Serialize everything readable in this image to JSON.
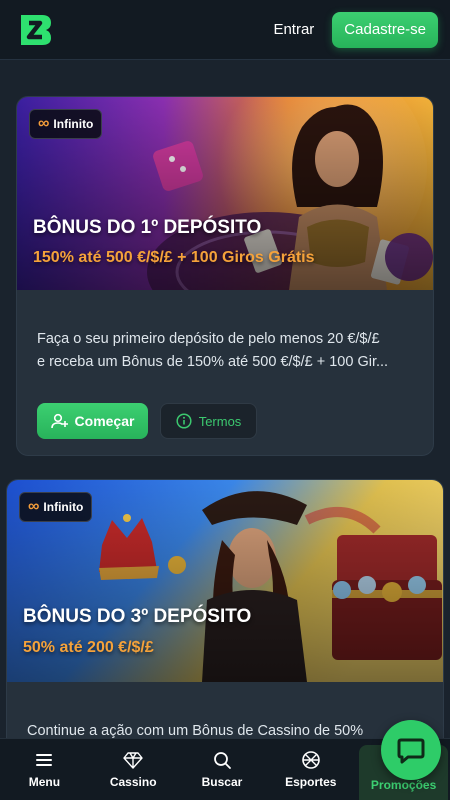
{
  "header": {
    "login_label": "Entrar",
    "signup_label": "Cadastre-se"
  },
  "promotions": [
    {
      "badge": "Infinito",
      "title": "BÔNUS DO 1º DEPÓSITO",
      "subtitle": "150% até 500 €/$/£ + 100 Giros Grátis",
      "description_line1": "Faça o seu primeiro depósito de pelo menos 20 €/$/£",
      "description_line2": "e receba um Bônus de 150% até 500 €/$/£ + 100 Gir...",
      "start_label": "Começar",
      "terms_label": "Termos"
    },
    {
      "badge": "Infinito",
      "title": "BÔNUS DO 3º DEPÓSITO",
      "subtitle": "50% até 200 €/$/£",
      "description_line1": "Continue a ação com um Bônus de Cassino de 50%"
    }
  ],
  "bottom_nav": {
    "items": [
      {
        "label": "Menu",
        "icon": "hamburger-icon"
      },
      {
        "label": "Cassino",
        "icon": "diamond-icon"
      },
      {
        "label": "Buscar",
        "icon": "search-icon"
      },
      {
        "label": "Esportes",
        "icon": "ball-icon"
      },
      {
        "label": "Promoções",
        "icon": "gift-icon"
      }
    ]
  },
  "colors": {
    "accent": "#3ccf71",
    "bonus_text": "#f5a23a",
    "background": "#1a232d"
  }
}
